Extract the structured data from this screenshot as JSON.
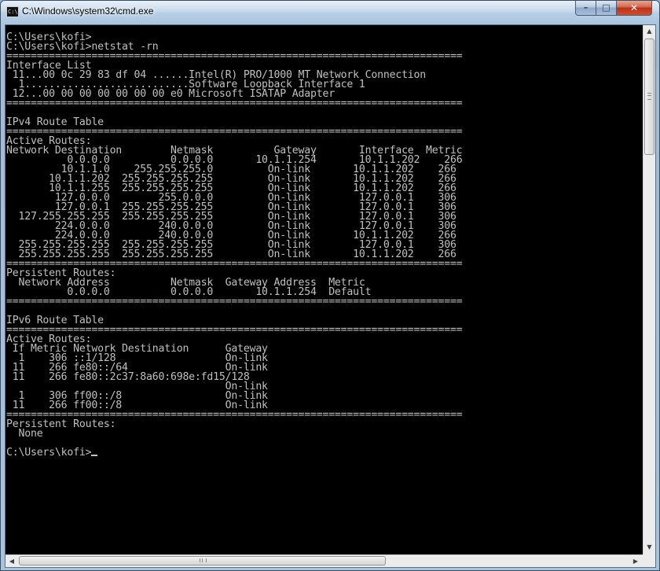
{
  "window": {
    "title": "C:\\Windows\\system32\\cmd.exe",
    "app_icon_text": "C:\\",
    "minimize_label": "–",
    "maximize_label": "□",
    "close_label": "✕"
  },
  "console": {
    "lines": [
      "C:\\Users\\kofi>",
      "C:\\Users\\kofi>netstat -rn",
      "===========================================================================",
      "Interface List",
      " 11...00 0c 29 83 df 04 ......Intel(R) PRO/1000 MT Network Connection",
      "  1...........................Software Loopback Interface 1",
      " 12...00 00 00 00 00 00 00 e0 Microsoft ISATAP Adapter",
      "===========================================================================",
      "",
      "IPv4 Route Table",
      "===========================================================================",
      "Active Routes:",
      "Network Destination        Netmask          Gateway       Interface  Metric",
      "          0.0.0.0          0.0.0.0       10.1.1.254       10.1.1.202    266",
      "         10.1.1.0    255.255.255.0         On-link       10.1.1.202    266",
      "       10.1.1.202  255.255.255.255         On-link       10.1.1.202    266",
      "       10.1.1.255  255.255.255.255         On-link       10.1.1.202    266",
      "        127.0.0.0        255.0.0.0         On-link        127.0.0.1    306",
      "        127.0.0.1  255.255.255.255         On-link        127.0.0.1    306",
      "  127.255.255.255  255.255.255.255         On-link        127.0.0.1    306",
      "        224.0.0.0        240.0.0.0         On-link        127.0.0.1    306",
      "        224.0.0.0        240.0.0.0         On-link       10.1.1.202    266",
      "  255.255.255.255  255.255.255.255         On-link        127.0.0.1    306",
      "  255.255.255.255  255.255.255.255         On-link       10.1.1.202    266",
      "===========================================================================",
      "Persistent Routes:",
      "  Network Address          Netmask  Gateway Address  Metric",
      "          0.0.0.0          0.0.0.0       10.1.1.254  Default",
      "===========================================================================",
      "",
      "IPv6 Route Table",
      "===========================================================================",
      "Active Routes:",
      " If Metric Network Destination      Gateway",
      "  1    306 ::1/128                  On-link",
      " 11    266 fe80::/64                On-link",
      " 11    266 fe80::2c37:8a60:698e:fd15/128",
      "                                    On-link",
      "  1    306 ff00::/8                 On-link",
      " 11    266 ff00::/8                 On-link",
      "===========================================================================",
      "Persistent Routes:",
      "  None",
      "",
      "C:\\Users\\kofi>"
    ]
  },
  "scrollbars": {
    "vertical": {
      "up_arrow": "▲",
      "down_arrow": "▼"
    },
    "horizontal": {
      "left_arrow": "◀",
      "right_arrow": "▶"
    }
  }
}
